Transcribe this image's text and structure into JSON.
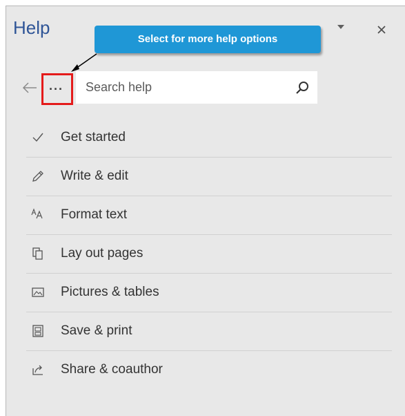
{
  "pane": {
    "title": "Help"
  },
  "callout": {
    "text": "Select for more help options"
  },
  "search": {
    "placeholder": "Search help",
    "value": ""
  },
  "menu": {
    "items": [
      {
        "label": "Get started",
        "icon": "checkmark-icon"
      },
      {
        "label": "Write & edit",
        "icon": "pencil-icon"
      },
      {
        "label": "Format text",
        "icon": "font-size-icon"
      },
      {
        "label": "Lay out pages",
        "icon": "pages-icon"
      },
      {
        "label": "Pictures & tables",
        "icon": "picture-icon"
      },
      {
        "label": "Save & print",
        "icon": "save-icon"
      },
      {
        "label": "Share & coauthor",
        "icon": "share-icon"
      }
    ]
  },
  "more_button": {
    "label": "···"
  },
  "colors": {
    "title": "#2f5597",
    "callout": "#1f97d6",
    "highlight_border": "#e41b1b",
    "pane_bg": "#e8e8e8"
  }
}
